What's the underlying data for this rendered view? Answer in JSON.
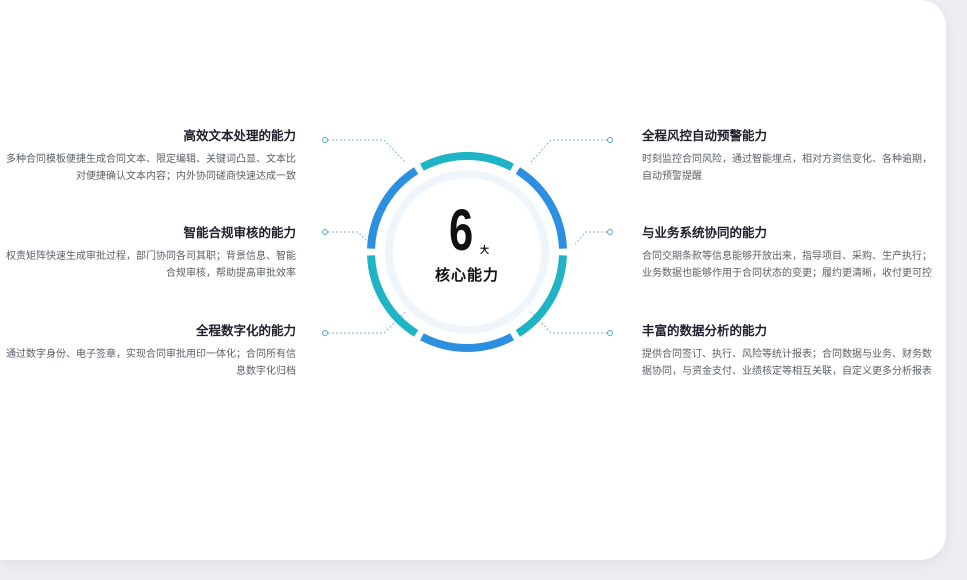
{
  "center": {
    "number": "6",
    "suffix": "大",
    "label": "核心能力"
  },
  "features": [
    {
      "title": "高效文本处理的能力",
      "desc": "多种合同模板便捷生成合同文本、限定编辑、关键词凸显、文本比对便捷确认文本内容；内外协同磋商快速达成一致"
    },
    {
      "title": "智能合规审核的能力",
      "desc": "权责矩阵快速生成审批过程，部门协同各司其职；背景信息、智能合规审核，帮助提高审批效率"
    },
    {
      "title": "全程数字化的能力",
      "desc": "通过数字身份、电子签章，实现合同审批用印一体化；合同所有信息数字化归档"
    },
    {
      "title": "全程风控自动预警能力",
      "desc": "时刻监控合同风险，通过智能埋点，相对方资信变化、各种逾期，自动预警提醒"
    },
    {
      "title": "与业务系统协同的能力",
      "desc": "合同交期条款等信息能够开放出来，指导项目、采购、生产执行；业务数据也能够作用于合同状态的变更；履约更清晰，收付更可控"
    },
    {
      "title": "丰富的数据分析的能力",
      "desc": "提供合同签订、执行、风险等统计报表；合同数据与业务、财务数据协同，与资金支付、业绩核定等相互关联，自定义更多分析报表"
    }
  ],
  "colors": {
    "ring_blue": "#2d8fe0",
    "ring_teal": "#1fb3c6",
    "connector": "#7fb6de",
    "inner_bg": "#f3f8fc"
  }
}
